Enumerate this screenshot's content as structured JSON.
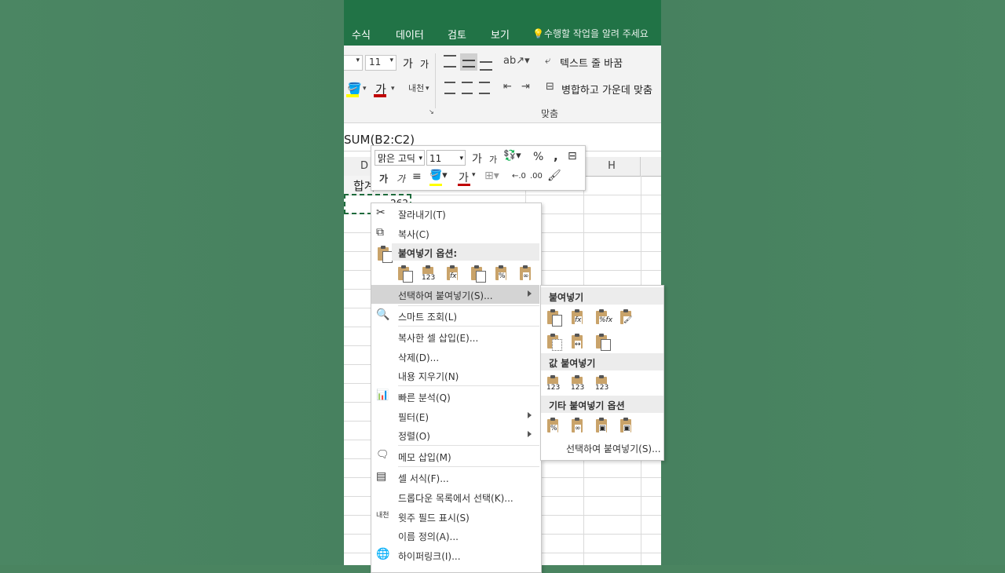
{
  "ribbon": {
    "tabs": [
      "수식",
      "데이터",
      "검토",
      "보기"
    ],
    "tell_me": "수행할 작업을 알려 주세요",
    "font_size": "11",
    "grow_font": "가",
    "shrink_font": "가",
    "font_color_glyph": "가",
    "phonetic": "내천",
    "wrap_text": "텍스트 줄 바꿈",
    "merge_center": "병합하고 가운데 맞춤",
    "alignment_group": "맞춤"
  },
  "formula_bar": {
    "text": "SUM(B2:C2)"
  },
  "sheet": {
    "columns": [
      "D",
      "H"
    ],
    "header_cell": "합계",
    "value_cell": "262"
  },
  "mini_toolbar": {
    "font_name": "맑은 고딕",
    "font_size": "11",
    "grow": "가",
    "shrink": "가",
    "percent": "%",
    "comma": ",",
    "bold": "가",
    "italic": "가",
    "font_color": "가",
    "inc_decimal": "←.0",
    "dec_decimal": ".00"
  },
  "context_menu": {
    "cut": "잘라내기(T)",
    "copy": "복사(C)",
    "paste_options": "붙여넣기 옵션:",
    "paste_special": "선택하여 붙여넣기(S)...",
    "smart_lookup": "스마트 조회(L)",
    "insert_copied": "복사한 셀 삽입(E)...",
    "delete": "삭제(D)...",
    "clear_contents": "내용 지우기(N)",
    "quick_analysis": "빠른 분석(Q)",
    "filter": "필터(E)",
    "sort": "정렬(O)",
    "insert_comment": "메모 삽입(M)",
    "format_cells": "셀 서식(F)...",
    "pick_dropdown": "드롭다운 목록에서 선택(K)...",
    "phonetic_field": "윗주 필드 표시(S)",
    "define_name": "이름 정의(A)...",
    "hyperlink": "하이퍼링크(I)..."
  },
  "paste_submenu": {
    "paste": "붙여넣기",
    "paste_values": "값 붙여넣기",
    "other_paste": "기타 붙여넣기 옵션",
    "paste_special": "선택하여 붙여넣기(S)..."
  },
  "colors": {
    "excel_green": "#217346",
    "highlight": "#d4d4d4",
    "font_red": "#c00000",
    "fill_yellow": "#ffff00"
  }
}
